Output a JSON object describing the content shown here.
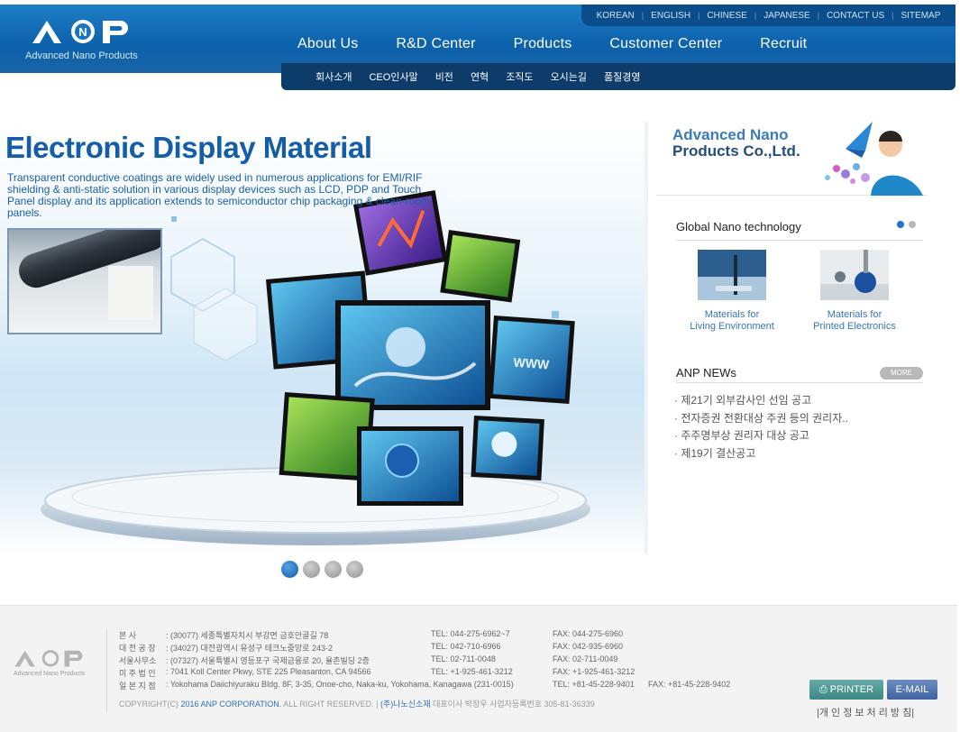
{
  "brand": {
    "logo_text": "ANP",
    "tagline": "Advanced Nano Products"
  },
  "util_nav": [
    "KOREAN",
    "ENGLISH",
    "CHINESE",
    "JAPANESE",
    "CONTACT US",
    "SITEMAP"
  ],
  "gnb": [
    "About Us",
    "R&D Center",
    "Products",
    "Customer Center",
    "Recruit"
  ],
  "sub_nav": [
    "회사소개",
    "CEO인사말",
    "비전",
    "연혁",
    "조직도",
    "오시는길",
    "품질경영"
  ],
  "hero": {
    "title": "Electronic Display Material",
    "description": "Transparent conductive coatings are widely used in numerous applications for EMI/RIF shielding & anti-static solution in various display devices such as LCD, PDP and Touch Panel display and its application extends to semiconductor chip packaging & clean-room panels.",
    "screen_label": "WWW",
    "slide_count": 4,
    "active_slide": 1
  },
  "side_banner": {
    "line1": "Advanced Nano",
    "line2": "Products Co.,Ltd."
  },
  "tech": {
    "title": "Global Nano technology",
    "cards": [
      {
        "caption_1": "Materials for",
        "caption_2": "Living Environment"
      },
      {
        "caption_1": "Materials for",
        "caption_2": "Printed Electronics"
      }
    ]
  },
  "news": {
    "title": "ANP NEWs",
    "more_label": "MORE",
    "items": [
      "· 제21기 외부감사인 선임 공고",
      "· 전자증권 전환대상 주권 등의 권리자..",
      "· 주주명부상 권리자 대상 공고",
      "· 제19기 결산공고"
    ]
  },
  "footer": {
    "logo_text": "ANP",
    "logo_tagline": "Advanced Nano Products",
    "rows": [
      {
        "label": "본      사",
        "addr": ": (30077) 세종특별자치시 부강면 금호안골길 78",
        "tel": "TEL: 044-275-6962~7",
        "fax": "FAX: 044-275-6960"
      },
      {
        "label": "대 전 공 장",
        "addr": ": (34027) 대전광역시 유성구 테크노중앙로 243-2",
        "tel": "TEL: 042-710-6966",
        "fax": "FAX: 042-935-6960"
      },
      {
        "label": "서울사무소",
        "addr": ": (07327) 서울특별시 영등포구 국제금융로 20, 율촌빌딩 2층",
        "tel": "TEL: 02-711-0048",
        "fax": "FAX: 02-711-0049"
      },
      {
        "label": "미 주 법 인",
        "addr": ": 7041 Koll Center Pkwy, STE 225 Pleasanton, CA 94566",
        "tel": "TEL: +1-925-461-3212",
        "fax": "FAX: +1-925-461-3212"
      },
      {
        "label": "일 본 지 점",
        "addr": ": Yokohama Daiichiyuraku Bldg. 8F, 3-35, Onoe-cho, Naka-ku, Yokohama, Kanagawa (231-0015)",
        "tel": "TEL: +81-45-228-9401",
        "fax": "FAX: +81-45-228-9402"
      }
    ],
    "copyright_prefix": "COPYRIGHT(C) ",
    "copyright_brand": "2016 ANP CORPORATION.",
    "copyright_suffix": " ALL RIGHT RESERVED.  |  ",
    "company_kr": "(주)나노신소재",
    "ceo_reg": "  대표이사 박장우  사업자등록번호 305-81-36339",
    "printer_label": "PRINTER",
    "email_label": "E-MAIL",
    "privacy_label": "|개 인 정 보 처 리 방 침|"
  },
  "colors": {
    "header_blue": "#0d63ad",
    "subnav_navy": "#0d3b6a",
    "title_blue": "#145da8",
    "link_blue": "#3677b6"
  }
}
